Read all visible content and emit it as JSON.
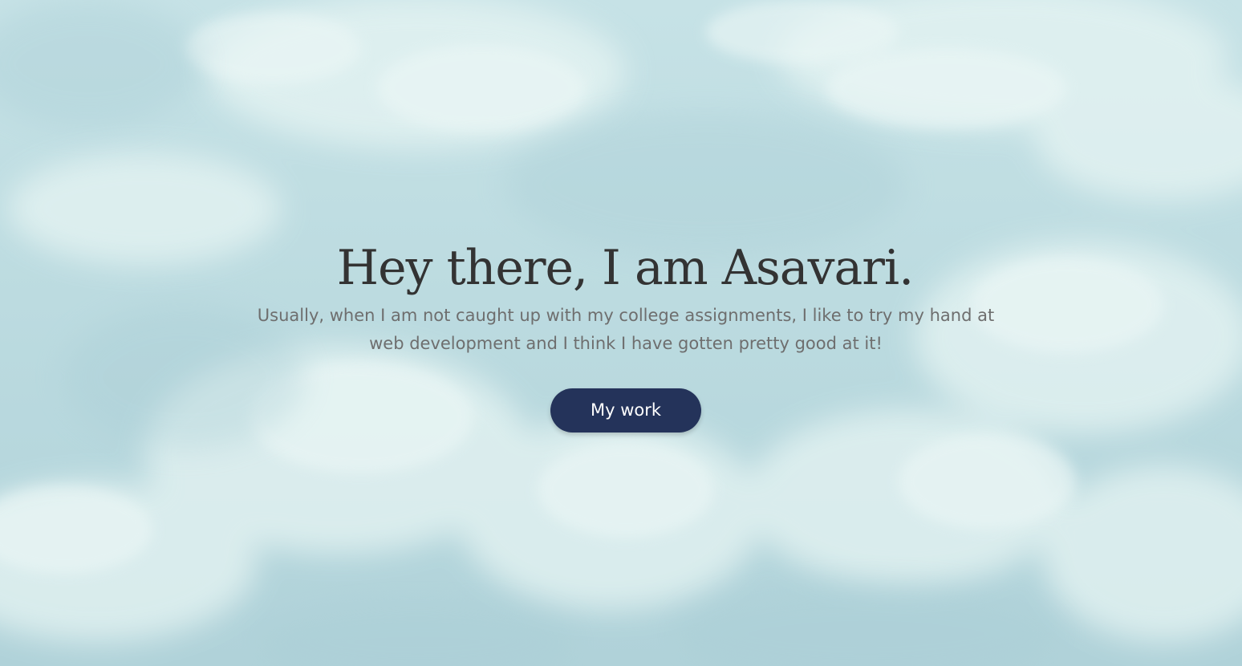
{
  "hero": {
    "headline": "Hey there, I am Asavari.",
    "subtitle": "Usually, when I am not caught up with my college assignments, I like to try my hand at web development and I think I have gotten pretty good at it!",
    "cta_label": "My work",
    "cta_color": "#24335a",
    "background": "sky with clouds"
  }
}
